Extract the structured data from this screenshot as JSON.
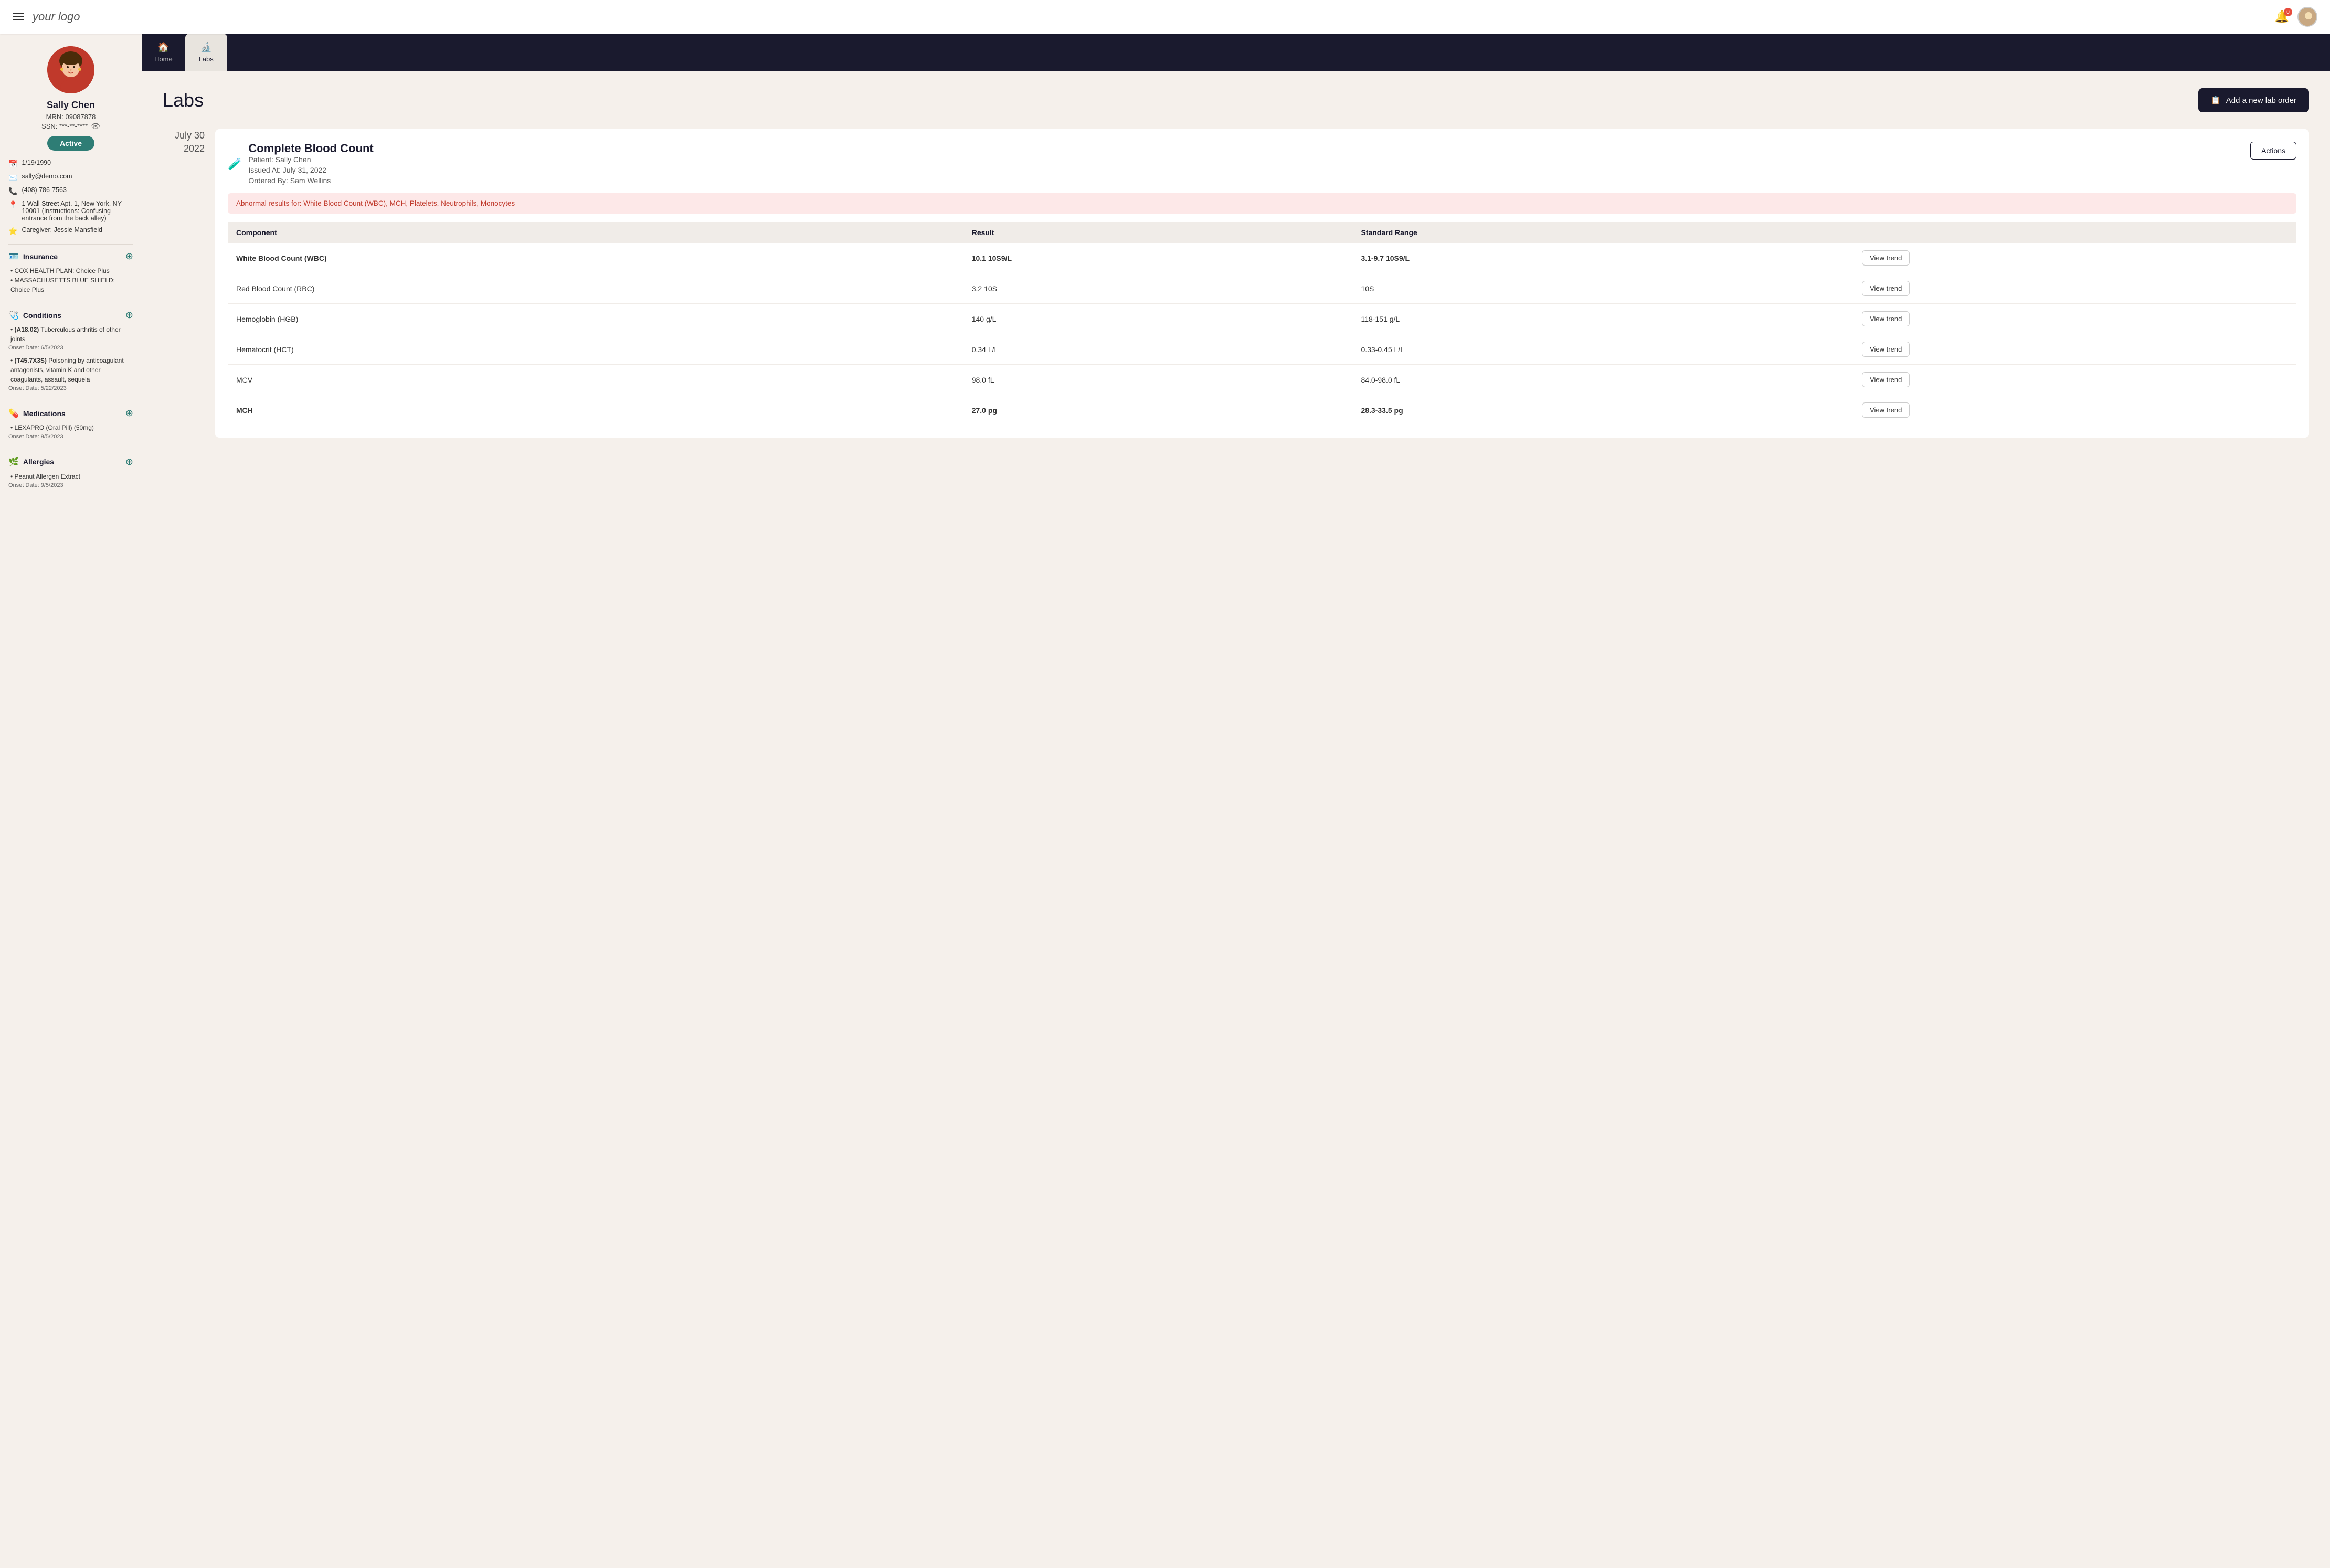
{
  "app": {
    "logo": "your logo",
    "notification_count": "0",
    "topbar": {
      "menu_label": "Menu",
      "notification_label": "Notifications",
      "avatar_label": "User Avatar"
    }
  },
  "nav": {
    "tabs": [
      {
        "id": "home",
        "label": "Home",
        "icon": "🏠",
        "active": false
      },
      {
        "id": "labs",
        "label": "Labs",
        "icon": "🔬",
        "active": true
      }
    ]
  },
  "patient": {
    "name": "Sally Chen",
    "mrn": "MRN: 09087878",
    "ssn": "SSN: ***-**-****",
    "status": "Active",
    "dob": "1/19/1990",
    "email": "sally@demo.com",
    "phone": "(408) 786-7563",
    "address": "1 Wall Street Apt. 1, New York, NY 10001 (Instructions: Confusing entrance from the back alley)",
    "caregiver": "Caregiver: Jessie Mansfield",
    "insurance": {
      "title": "Insurance",
      "plans": [
        "COX HEALTH PLAN: Choice Plus",
        "MASSACHUSETTS BLUE SHIELD: Choice Plus"
      ]
    },
    "conditions": {
      "title": "Conditions",
      "items": [
        {
          "code": "A18.02",
          "name": "Tuberculous arthritis of other joints",
          "onset": "Onset Date: 6/5/2023"
        },
        {
          "code": "T45.7X3S",
          "name": "Poisoning by anticoagulant antagonists, vitamin K and other coagulants, assault, sequela",
          "onset": "Onset Date: 5/22/2023"
        }
      ]
    },
    "medications": {
      "title": "Medications",
      "items": [
        {
          "name": "LEXAPRO (Oral Pill) (50mg)",
          "onset": "Onset Date: 9/5/2023"
        }
      ]
    },
    "allergies": {
      "title": "Allergies",
      "items": [
        {
          "name": "Peanut Allergen Extract",
          "onset": "Onset Date: 9/5/2023"
        }
      ]
    }
  },
  "page": {
    "title": "Labs",
    "add_lab_btn": "Add a new lab order"
  },
  "lab_orders": [
    {
      "date_line1": "July 30",
      "date_line2": "2022",
      "title": "Complete Blood Count",
      "patient": "Patient: Sally Chen",
      "issued": "Issued At: July 31, 2022",
      "ordered_by": "Ordered By: Sam Wellins",
      "actions_label": "Actions",
      "abnormal_banner": "Abnormal results for: White Blood Count (WBC), MCH, Platelets, Neutrophils, Monocytes",
      "table": {
        "headers": [
          "Component",
          "Result",
          "Standard Range",
          ""
        ],
        "rows": [
          {
            "component": "White Blood Count (WBC)",
            "result": "10.1 10S9/L",
            "range": "3.1-9.7 10S9/L",
            "abnormal": true,
            "btn": "View trend"
          },
          {
            "component": "Red Blood Count (RBC)",
            "result": "3.2 10S",
            "range": "10S",
            "abnormal": false,
            "btn": "View trend"
          },
          {
            "component": "Hemoglobin (HGB)",
            "result": "140 g/L",
            "range": "118-151 g/L",
            "abnormal": false,
            "btn": "View trend"
          },
          {
            "component": "Hematocrit (HCT)",
            "result": "0.34 L/L",
            "range": "0.33-0.45 L/L",
            "abnormal": false,
            "btn": "View trend"
          },
          {
            "component": "MCV",
            "result": "98.0 fL",
            "range": "84.0-98.0 fL",
            "abnormal": false,
            "btn": "View trend"
          },
          {
            "component": "MCH",
            "result": "27.0 pg",
            "range": "28.3-33.5 pg",
            "abnormal": true,
            "btn": "View trend"
          }
        ]
      }
    }
  ]
}
